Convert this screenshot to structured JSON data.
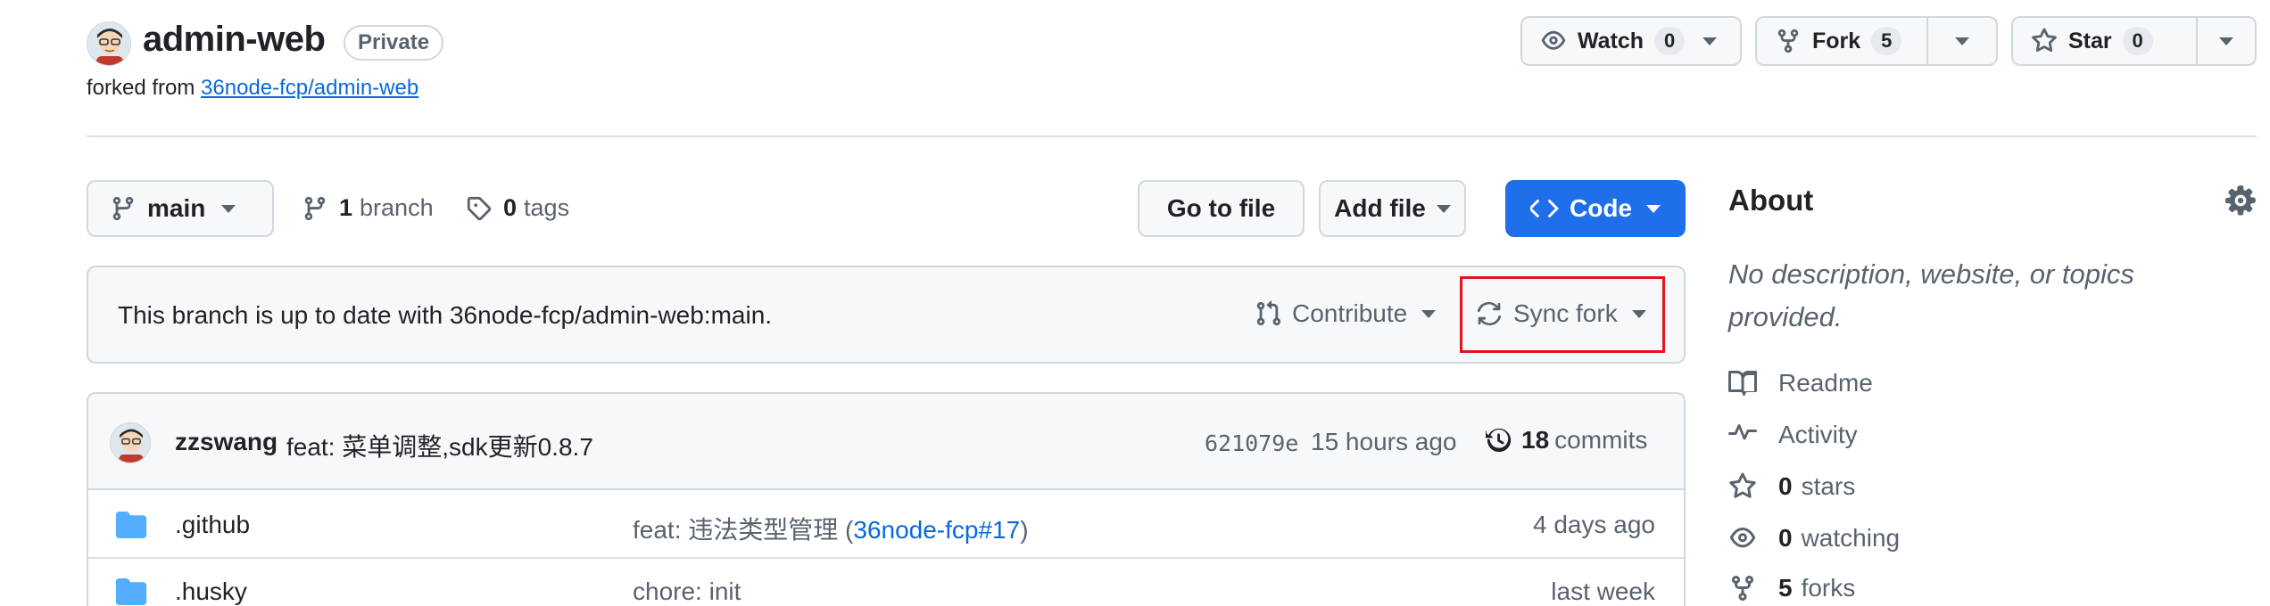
{
  "repo": {
    "name": "admin-web",
    "visibility": "Private",
    "forked_from_prefix": "forked from",
    "forked_from_link": "36node-fcp/admin-web"
  },
  "actions": {
    "watch": {
      "label": "Watch",
      "count": "0"
    },
    "fork": {
      "label": "Fork",
      "count": "5"
    },
    "star": {
      "label": "Star",
      "count": "0"
    }
  },
  "toolbar": {
    "branch": "main",
    "branches_count": "1",
    "branches_label": "branch",
    "tags_count": "0",
    "tags_label": "tags",
    "goto_file": "Go to file",
    "add_file": "Add file",
    "code": "Code"
  },
  "sync": {
    "status": "This branch is up to date with 36node-fcp/admin-web:main.",
    "contribute": "Contribute",
    "sync_fork": "Sync fork"
  },
  "latest_commit": {
    "author": "zzswang",
    "message": "feat: 菜单调整,sdk更新0.8.7",
    "sha": "621079e",
    "time": "15 hours ago",
    "commits_count": "18",
    "commits_label": "commits"
  },
  "files": [
    {
      "name": ".github",
      "message_prefix": "feat: 违法类型管理 (",
      "message_link": "36node-fcp#17",
      "message_suffix": ")",
      "time": "4 days ago"
    },
    {
      "name": ".husky",
      "message_prefix": "chore: init",
      "message_link": "",
      "message_suffix": "",
      "time": "last week"
    }
  ],
  "about": {
    "title": "About",
    "description": "No description, website, or topics provided.",
    "items": [
      {
        "icon": "book-icon",
        "count": "",
        "label": "Readme"
      },
      {
        "icon": "pulse-icon",
        "count": "",
        "label": "Activity"
      },
      {
        "icon": "star-icon",
        "count": "0",
        "label": "stars"
      },
      {
        "icon": "eye-icon",
        "count": "0",
        "label": "watching"
      },
      {
        "icon": "fork-icon",
        "count": "5",
        "label": "forks"
      }
    ]
  },
  "colors": {
    "accent_blue": "#1f6feb",
    "link_blue": "#0969da",
    "highlight_red": "#e5131d",
    "muted_text": "#59636e"
  }
}
